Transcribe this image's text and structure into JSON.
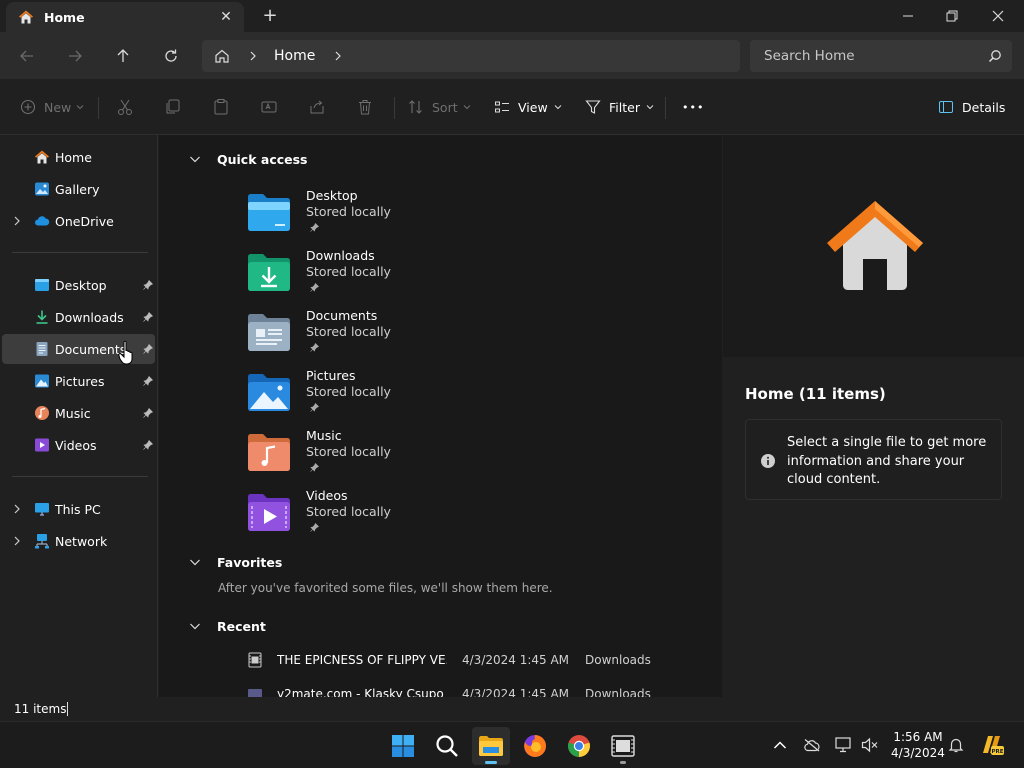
{
  "window": {
    "tab_title": "Home",
    "tab_close": "✕",
    "new_tab": "+"
  },
  "nav": {
    "breadcrumb": "Home",
    "search_placeholder": "Search Home"
  },
  "commandbar": {
    "new_label": "New",
    "sort_label": "Sort",
    "view_label": "View",
    "filter_label": "Filter",
    "more_label": "•••",
    "details_label": "Details"
  },
  "sidebar": {
    "top": [
      {
        "label": "Home"
      },
      {
        "label": "Gallery"
      },
      {
        "label": "OneDrive"
      }
    ],
    "pinned": [
      {
        "label": "Desktop"
      },
      {
        "label": "Downloads"
      },
      {
        "label": "Documents"
      },
      {
        "label": "Pictures"
      },
      {
        "label": "Music"
      },
      {
        "label": "Videos"
      }
    ],
    "bottom": [
      {
        "label": "This PC"
      },
      {
        "label": "Network"
      }
    ]
  },
  "main": {
    "quick_access_title": "Quick access",
    "quick_access": [
      {
        "name": "Desktop",
        "sub": "Stored locally",
        "icon": "desktop-folder-icon"
      },
      {
        "name": "Downloads",
        "sub": "Stored locally",
        "icon": "downloads-folder-icon"
      },
      {
        "name": "Documents",
        "sub": "Stored locally",
        "icon": "documents-folder-icon"
      },
      {
        "name": "Pictures",
        "sub": "Stored locally",
        "icon": "pictures-folder-icon"
      },
      {
        "name": "Music",
        "sub": "Stored locally",
        "icon": "music-folder-icon"
      },
      {
        "name": "Videos",
        "sub": "Stored locally",
        "icon": "videos-folder-icon"
      }
    ],
    "favorites_title": "Favorites",
    "favorites_empty": "After you've favorited some files, we'll show them here.",
    "recent_title": "Recent",
    "recent": [
      {
        "name": "THE EPICNESS OF FLIPPY VE...",
        "date": "4/3/2024 1:45 AM",
        "location": "Downloads"
      },
      {
        "name": "y2mate.com - Klasky Csupo ...",
        "date": "4/3/2024 1:45 AM",
        "location": "Downloads"
      }
    ]
  },
  "details": {
    "title": "Home (11 items)",
    "info": "Select a single file to get more information and share your cloud content."
  },
  "status": {
    "items": "11 items"
  },
  "taskbar": {
    "time": "1:56 AM",
    "date": "4/3/2024"
  },
  "colors": {
    "accent": "#5ec3f0",
    "home_roof": "#f07a1a",
    "background": "#202020"
  }
}
